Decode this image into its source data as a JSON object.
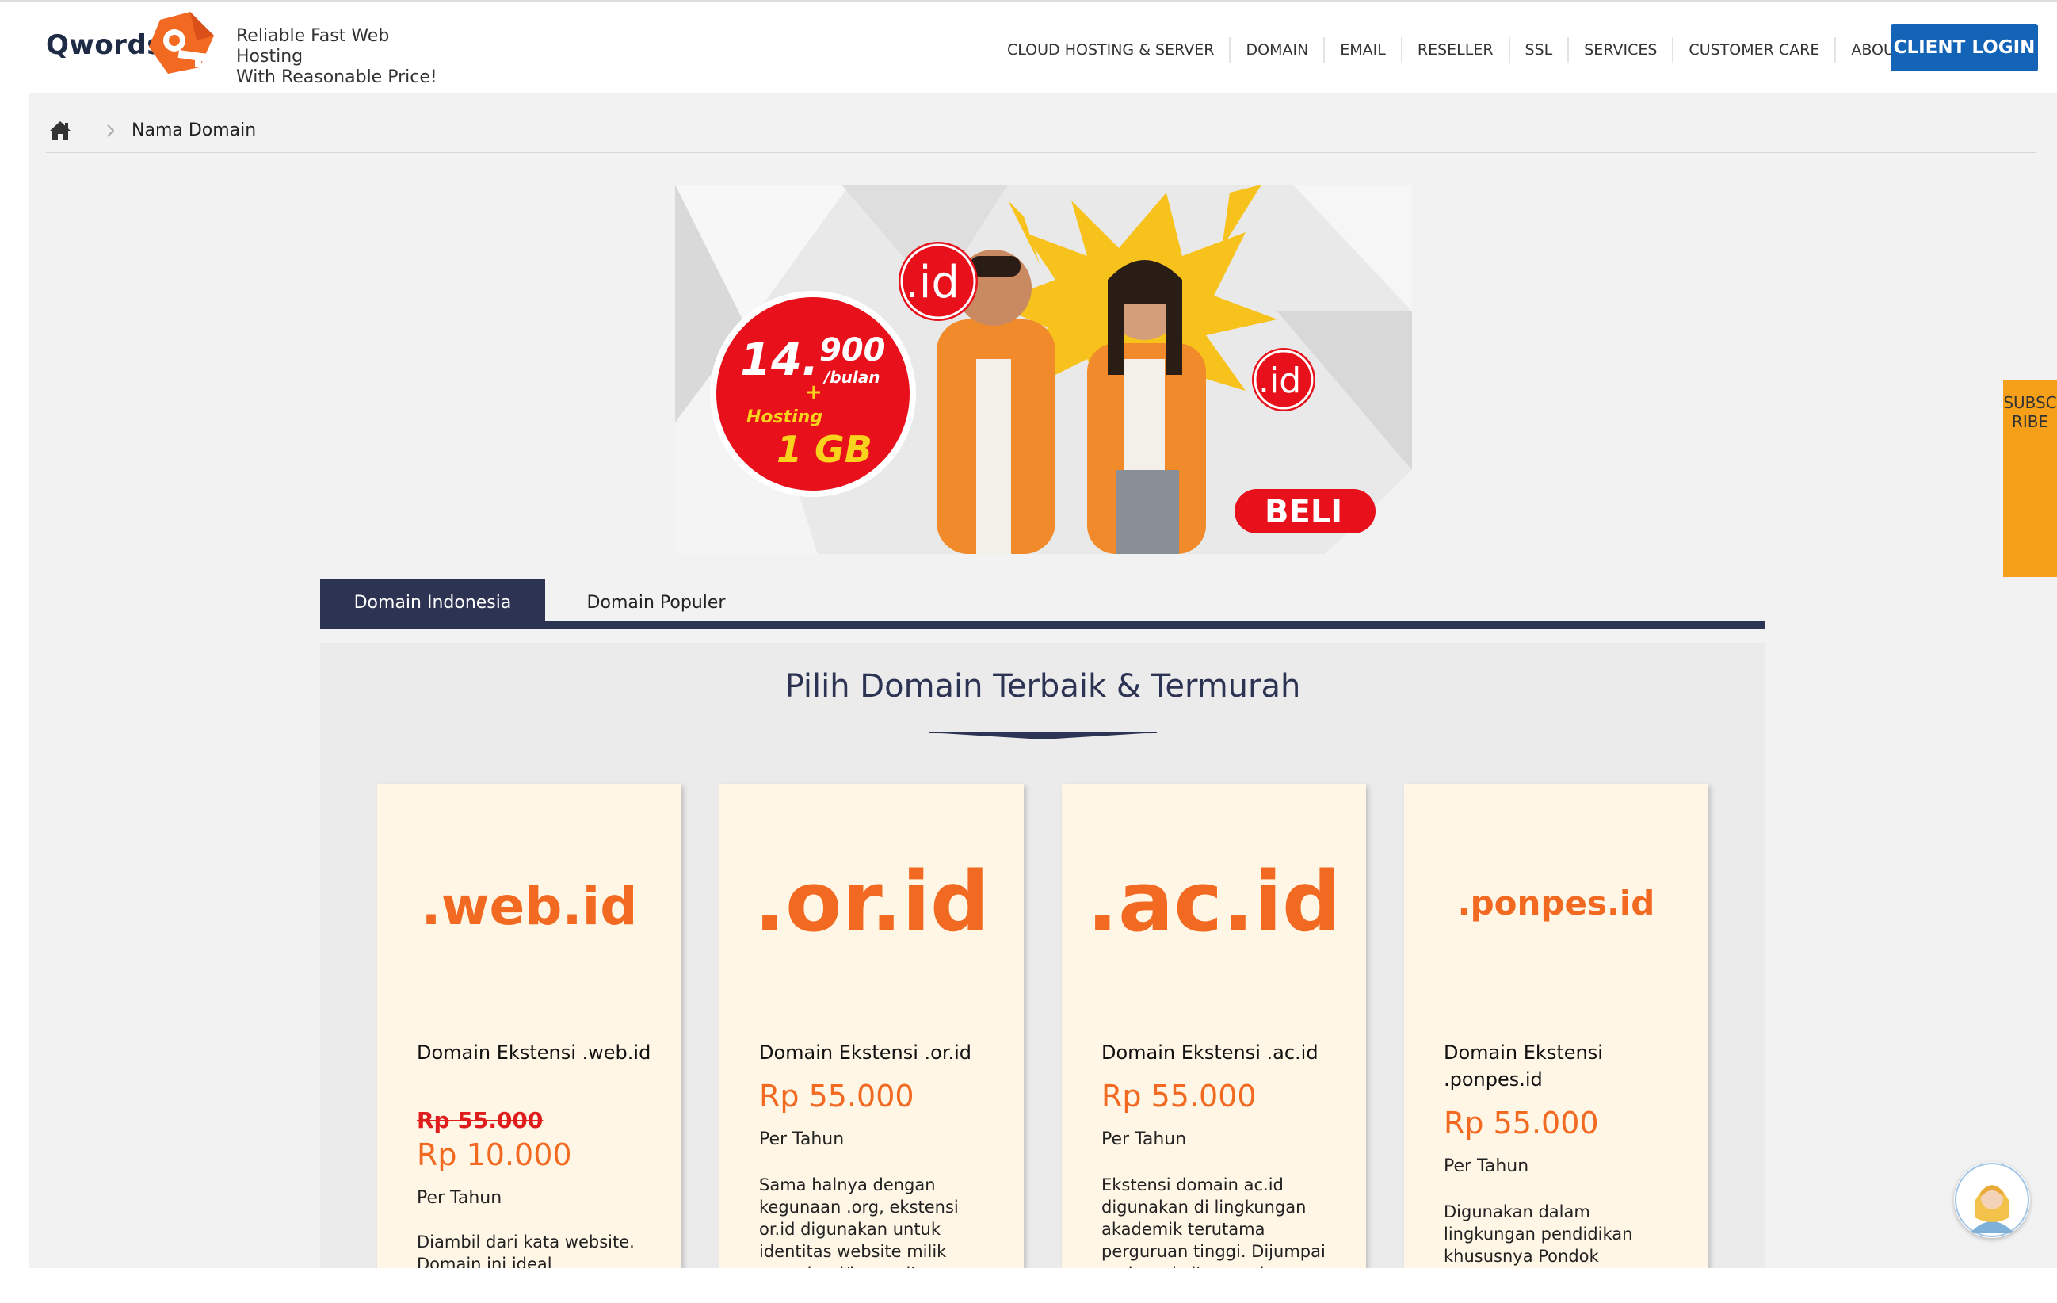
{
  "header": {
    "logo_text": "Qwords",
    "tagline_line1": "Reliable Fast Web Hosting",
    "tagline_line2": "With Reasonable Price!",
    "nav": [
      "CLOUD HOSTING & SERVER",
      "DOMAIN",
      "EMAIL",
      "RESELLER",
      "SSL",
      "SERVICES",
      "CUSTOMER CARE",
      "ABOUT"
    ],
    "login_label": "CLIENT LOGIN"
  },
  "breadcrumb": {
    "label": "Nama Domain"
  },
  "banner": {
    "price_main": "14.",
    "price_sup": "900",
    "price_unit": "/bulan",
    "plus": "+",
    "hosting": "Hosting",
    "size": "1 GB",
    "id_badge": ".id",
    "cta": "BELI"
  },
  "tabs": {
    "active": "Domain Indonesia",
    "inactive": "Domain Populer"
  },
  "section": {
    "title": "Pilih Domain Terbaik & Termurah"
  },
  "cards": [
    {
      "ext": ".web.id",
      "name": "Domain Ekstensi .web.id",
      "old_price": "Rp  55.000",
      "price": "Rp  10.000",
      "per": "Per Tahun",
      "desc": "Diambil dari kata website. Domain ini ideal"
    },
    {
      "ext": ".or.id",
      "name": "Domain Ekstensi .or.id",
      "price": "Rp  55.000",
      "per": "Per Tahun",
      "desc": "Sama halnya dengan kegunaan .org, ekstensi or.id digunakan untuk identitas website milik organisasi/komunitas"
    },
    {
      "ext": ".ac.id",
      "name": "Domain Ekstensi .ac.id",
      "price": "Rp  55.000",
      "per": "Per Tahun",
      "desc": "Ekstensi domain ac.id digunakan di lingkungan akademik terutama perguruan tinggi. Dijumpai pada website resmi"
    },
    {
      "ext": ".ponpes.id",
      "name": "Domain Ekstensi .ponpes.id",
      "price": "Rp  55.000",
      "per": "Per Tahun",
      "desc": "Digunakan dalam lingkungan pendidikan khususnya Pondok Pesantren"
    }
  ],
  "subscribe": {
    "label": "SUBSCRIBE"
  },
  "colors": {
    "accent": "#f26a21",
    "navy": "#2d3352",
    "login": "#1363b6",
    "subscribe": "#f6a01a",
    "red": "#e01d1d"
  }
}
